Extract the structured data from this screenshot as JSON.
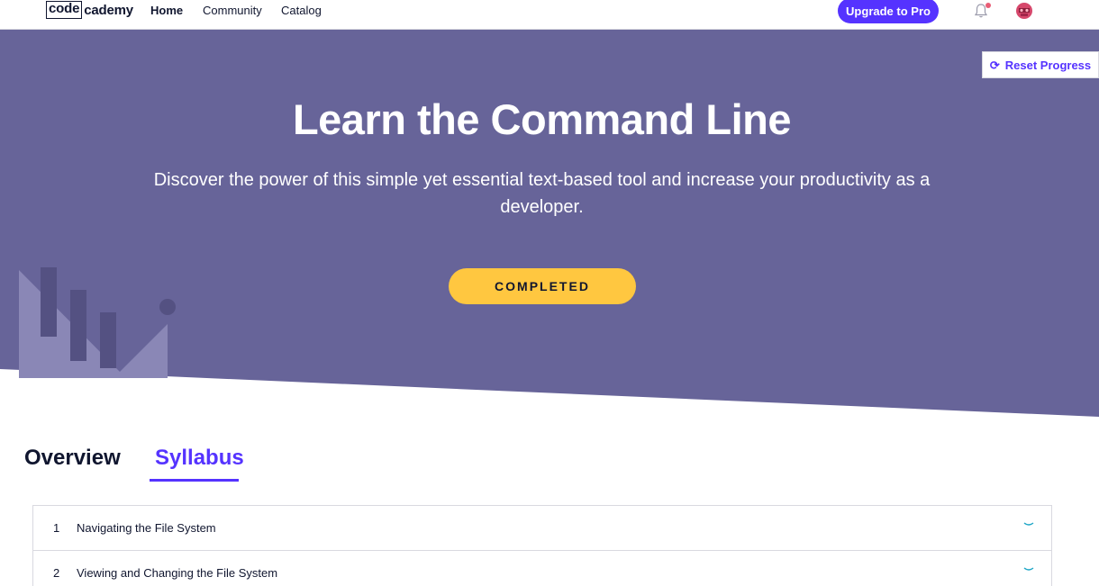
{
  "nav": {
    "logo_box": "code",
    "logo_rest": "cademy",
    "links": [
      "Home",
      "Community",
      "Catalog"
    ],
    "upgrade_label": "Upgrade to Pro"
  },
  "hero": {
    "reset_label": "Reset Progress",
    "title": "Learn the Command Line",
    "description": "Discover the power of this simple yet essential text-based tool and increase your productivity as a developer.",
    "status_label": "COMPLETED"
  },
  "tabs": [
    "Overview",
    "Syllabus"
  ],
  "active_tab": "Syllabus",
  "syllabus": [
    {
      "number": "1",
      "title": "Navigating the File System"
    },
    {
      "number": "2",
      "title": "Viewing and Changing the File System"
    }
  ],
  "colors": {
    "hero_bg": "#676499",
    "accent": "#5533ff",
    "completed": "#ffc740",
    "chevron": "#1ea6c6"
  },
  "icons": {
    "reset": "refresh-icon",
    "bell": "bell-icon",
    "chevron": "chevron-down-icon"
  }
}
